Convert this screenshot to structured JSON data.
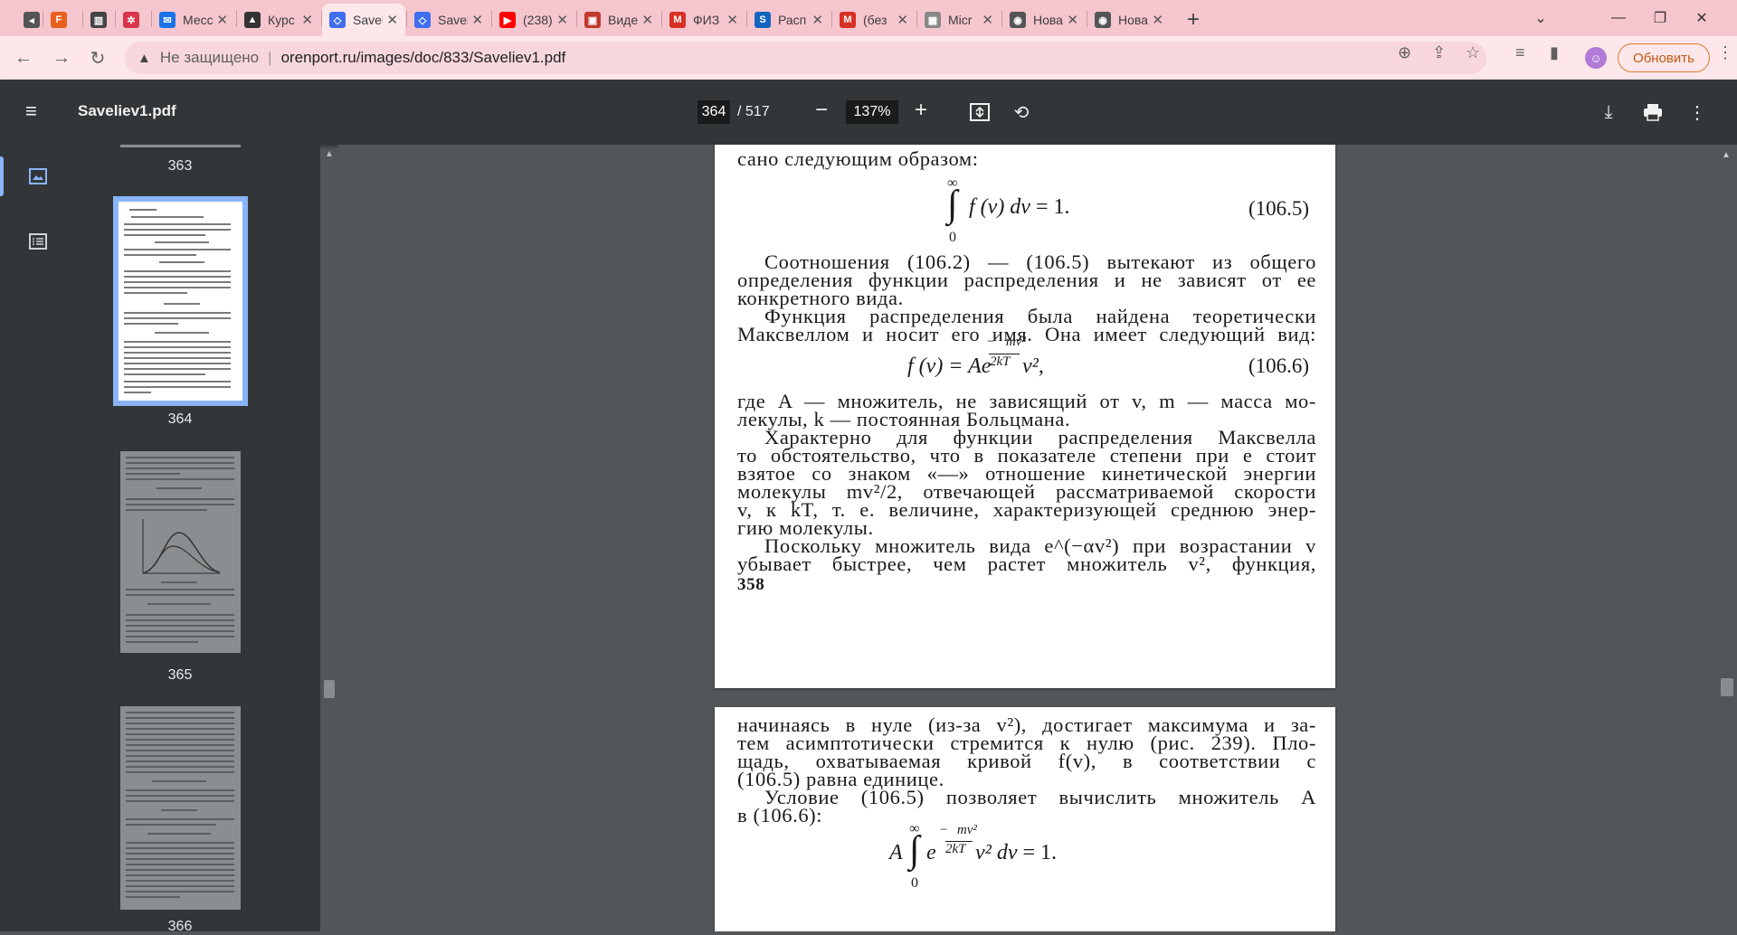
{
  "browser": {
    "tabs": [
      {
        "title": "",
        "icon": "speaker-icon",
        "color": "#555555"
      },
      {
        "title": "",
        "icon": "f-app-icon",
        "color": "#e8601c"
      },
      {
        "title": "",
        "icon": "book-icon",
        "color": "#444444"
      },
      {
        "title": "",
        "icon": "bug-icon",
        "color": "#d8344a"
      },
      {
        "title": "Месс",
        "icon": "messenger-icon",
        "color": "#1a73e8"
      },
      {
        "title": "Курс",
        "icon": "graduation-cap-icon",
        "color": "#333333"
      },
      {
        "title": "Savel",
        "icon": "pdf-icon",
        "color": "#3f6ef0",
        "active": true
      },
      {
        "title": "Savel",
        "icon": "pdf-icon",
        "color": "#3f6ef0"
      },
      {
        "title": "(238)",
        "icon": "youtube-icon",
        "color": "#ff0000"
      },
      {
        "title": "Виде",
        "icon": "video-icon",
        "color": "#c0392b"
      },
      {
        "title": "ФИЗ",
        "icon": "gmail-icon",
        "color": "#d93025"
      },
      {
        "title": "Расп",
        "icon": "s-icon",
        "color": "#1565c0"
      },
      {
        "title": "(без",
        "icon": "gmail-icon",
        "color": "#d93025"
      },
      {
        "title": "Micr",
        "icon": "microsoft-icon",
        "color": "#888888"
      },
      {
        "title": "Нова",
        "icon": "chrome-icon",
        "color": "#555555"
      },
      {
        "title": "Нова",
        "icon": "chrome-icon",
        "color": "#555555"
      }
    ],
    "new_tab": "+",
    "address": {
      "security_label": "Не защищено",
      "url": "orenport.ru/images/doc/833/Saveliev1.pdf"
    },
    "update_label": "Обновить"
  },
  "pdf": {
    "doc_title": "Saveliev1.pdf",
    "current_page": "364",
    "total_pages": "/ 517",
    "zoom": "137%",
    "zoom_out": "−",
    "zoom_in": "+"
  },
  "thumbnails": [
    {
      "page": "363"
    },
    {
      "page": "364",
      "active": true
    },
    {
      "page": "365"
    },
    {
      "page": "366"
    }
  ],
  "page1": {
    "line_top": "сано следующим образом:",
    "eq1_number": "(106.5)",
    "para1": [
      "Соотношения (106.2) — (106.5) вытекают из общего",
      "определения функции распределения и не зависят от ее",
      "конкретного вида."
    ],
    "para2": [
      "Функция распределения была найдена теоретически",
      "Максвеллом и носит его имя. Она имеет следующий вид:"
    ],
    "eq2_number": "(106.6)",
    "para3": [
      "где A — множитель, не зависящий от v, m — масса мо-",
      "лекулы, k — постоянная Больцмана."
    ],
    "para4": [
      "Характерно для функции распределения Максвелла",
      "то обстоятельство, что в показателе степени при e стоит",
      "взятое со знаком «—» отношение кинетической энергии",
      "молекулы mv²/2, отвечающей рассматриваемой скорости",
      "v, к kT, т. е. величине, характеризующей среднюю энер-",
      "гию молекулы."
    ],
    "para5": [
      "Поскольку множитель вида e^(−αv²) при возрастании v",
      "убывает быстрее, чем растет множитель v², функция,"
    ],
    "page_number": "358"
  },
  "page2": {
    "para1": [
      "начинаясь в нуле (из-за v²), достигает максимума и за-",
      "тем асимптотически стремится к нулю (рис. 239). Пло-",
      "щадь, охватываемая кривой f(v), в соответствии с",
      "(106.5) равна единице."
    ],
    "para2": [
      "Условие (106.5) позволяет вычислить множитель A",
      "в (106.6):"
    ]
  }
}
